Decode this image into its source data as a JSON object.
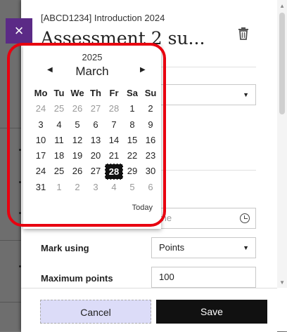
{
  "panel": {
    "course": "[ABCD1234] Introduction 2024",
    "title": "Assessment 2 su...",
    "close_glyph": "×"
  },
  "form": {
    "time_placeholder": "me",
    "mark_using_label": "Mark using",
    "mark_using_value": "Points",
    "max_points_label": "Maximum points",
    "max_points_value": "100"
  },
  "datepicker": {
    "year": "2025",
    "month": "March",
    "weekdays": [
      "Mo",
      "Tu",
      "We",
      "Th",
      "Fr",
      "Sa",
      "Su"
    ],
    "weeks": [
      [
        {
          "d": "24",
          "m": true
        },
        {
          "d": "25",
          "m": true
        },
        {
          "d": "26",
          "m": true
        },
        {
          "d": "27",
          "m": true
        },
        {
          "d": "28",
          "m": true
        },
        {
          "d": "1"
        },
        {
          "d": "2"
        }
      ],
      [
        {
          "d": "3"
        },
        {
          "d": "4"
        },
        {
          "d": "5"
        },
        {
          "d": "6"
        },
        {
          "d": "7"
        },
        {
          "d": "8"
        },
        {
          "d": "9"
        }
      ],
      [
        {
          "d": "10"
        },
        {
          "d": "11"
        },
        {
          "d": "12"
        },
        {
          "d": "13"
        },
        {
          "d": "14"
        },
        {
          "d": "15"
        },
        {
          "d": "16"
        }
      ],
      [
        {
          "d": "17"
        },
        {
          "d": "18"
        },
        {
          "d": "19"
        },
        {
          "d": "20"
        },
        {
          "d": "21"
        },
        {
          "d": "22"
        },
        {
          "d": "23"
        }
      ],
      [
        {
          "d": "24"
        },
        {
          "d": "25"
        },
        {
          "d": "26"
        },
        {
          "d": "27"
        },
        {
          "d": "28",
          "s": true
        },
        {
          "d": "29"
        },
        {
          "d": "30"
        }
      ],
      [
        {
          "d": "31"
        },
        {
          "d": "1",
          "m": true
        },
        {
          "d": "2",
          "m": true
        },
        {
          "d": "3",
          "m": true
        },
        {
          "d": "4",
          "m": true
        },
        {
          "d": "5",
          "m": true
        },
        {
          "d": "6",
          "m": true
        }
      ]
    ],
    "today_label": "Today"
  },
  "footer": {
    "cancel_label": "Cancel",
    "save_label": "Save"
  },
  "colors": {
    "accent": "#5b2a86",
    "highlight": "#e8000f",
    "save_bg": "#111111",
    "cancel_bg": "#dcdcf8"
  },
  "icons": [
    "close-icon",
    "trash-icon",
    "chevron-left-icon",
    "chevron-right-icon",
    "clock-icon",
    "chevron-down-icon"
  ]
}
